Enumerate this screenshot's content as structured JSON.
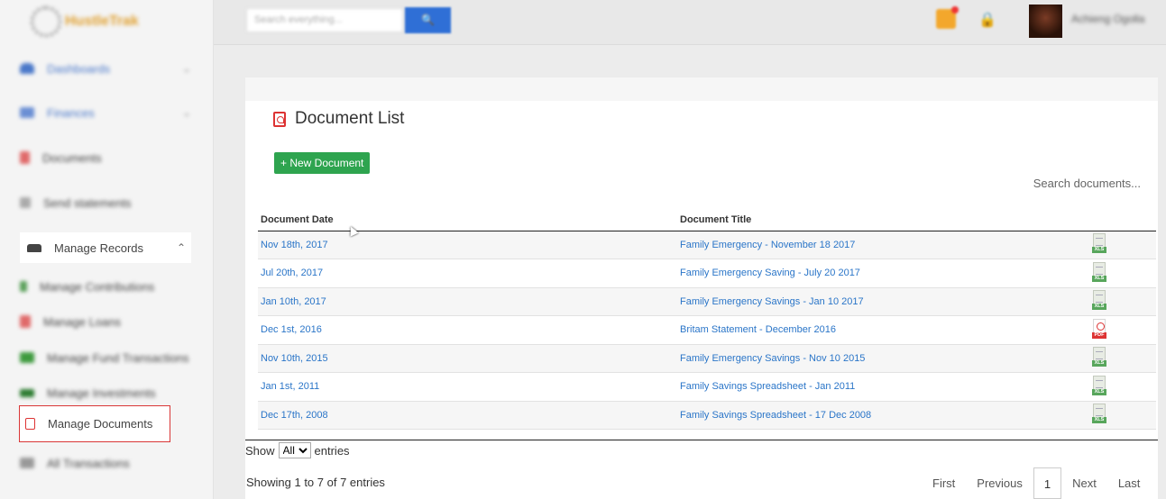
{
  "app": {
    "logo_text": "HustleTrak"
  },
  "topbar": {
    "search_placeholder": "Search everything...",
    "search_button": "🔍",
    "user_name": "Achieng Ogolla"
  },
  "sidebar": {
    "items": [
      {
        "label": "Dashboards",
        "chevron": "⌄"
      },
      {
        "label": "Finances",
        "chevron": "⌄"
      },
      {
        "label": "Documents",
        "chevron": ""
      },
      {
        "label": "Send statements",
        "chevron": ""
      }
    ],
    "manage_records": {
      "label": "Manage Records",
      "chevron": "⌃"
    },
    "sub_items": [
      {
        "label": "Manage Contributions"
      },
      {
        "label": "Manage Loans"
      },
      {
        "label": "Manage Fund Transactions"
      },
      {
        "label": "Manage Investments"
      },
      {
        "label": "Manage Documents"
      },
      {
        "label": "All Transactions"
      }
    ]
  },
  "main": {
    "title": "Document List",
    "new_button": "+ New Document",
    "search_label": "Search documents...",
    "table": {
      "headers": [
        "Document Date",
        "Document Title",
        ""
      ],
      "rows": [
        {
          "date": "Nov 18th, 2017",
          "title": "Family Emergency - November 18 2017",
          "type": "XLS"
        },
        {
          "date": "Jul 20th, 2017",
          "title": "Family Emergency Saving - July 20 2017",
          "type": "XLS"
        },
        {
          "date": "Jan 10th, 2017",
          "title": "Family Emergency Savings - Jan 10 2017",
          "type": "XLS"
        },
        {
          "date": "Dec 1st, 2016",
          "title": "Britam Statement - December 2016",
          "type": "PDF"
        },
        {
          "date": "Nov 10th, 2015",
          "title": "Family Emergency Savings - Nov 10 2015",
          "type": "XLS"
        },
        {
          "date": "Jan 1st, 2011",
          "title": "Family Savings Spreadsheet - Jan 2011",
          "type": "XLS"
        },
        {
          "date": "Dec 17th, 2008",
          "title": "Family Savings Spreadsheet - 17 Dec 2008",
          "type": "XLS"
        }
      ]
    },
    "show_label": "Show",
    "show_value": "All",
    "entries_label": "entries",
    "showing_text": "Showing 1 to 7 of 7 entries",
    "pager": {
      "first": "First",
      "previous": "Previous",
      "current": "1",
      "next": "Next",
      "last": "Last"
    }
  },
  "colors": {
    "accent": "#2f6fd6",
    "new_button": "#2ea44f",
    "link": "#2a75c8",
    "active_border": "#d93636"
  }
}
